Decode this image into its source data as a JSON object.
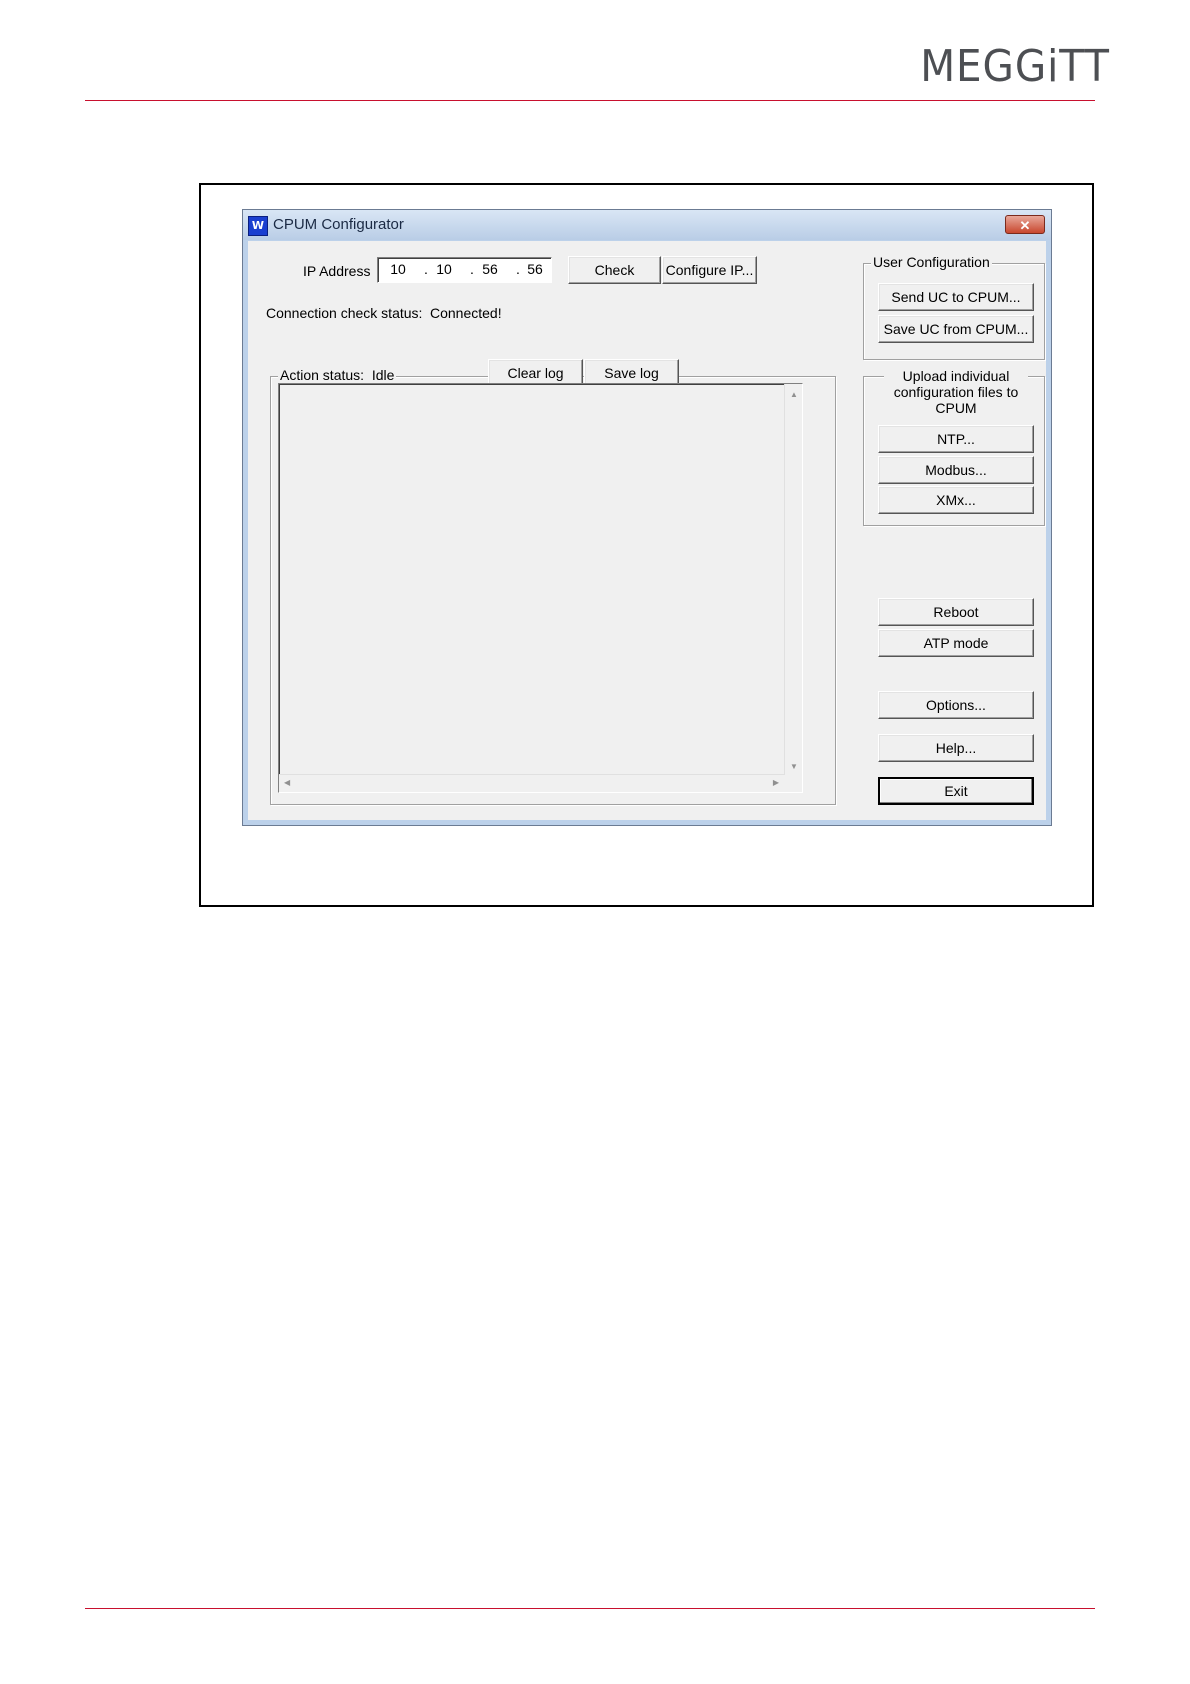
{
  "header": {
    "logo_text": "MEGGiTT"
  },
  "window": {
    "title": "CPUM Configurator",
    "close_glyph": "✕",
    "ip": {
      "label": "IP Address",
      "octets": [
        "10",
        "10",
        "56",
        "56"
      ],
      "separator": "."
    },
    "buttons": {
      "check": "Check",
      "configure_ip": "Configure IP...",
      "clear_log": "Clear log",
      "save_log": "Save log",
      "reboot": "Reboot",
      "atp_mode": "ATP mode",
      "options": "Options...",
      "help": "Help...",
      "exit": "Exit"
    },
    "connection": {
      "label": "Connection check status:",
      "value": "Connected!"
    },
    "action": {
      "label": "Action status:",
      "value": "Idle"
    },
    "user_configuration": {
      "title": "User Configuration",
      "send": "Send UC to CPUM...",
      "save": "Save UC from CPUM..."
    },
    "upload_group": {
      "title_line1": "Upload individual",
      "title_line2": "configuration files to",
      "title_line3": "CPUM",
      "ntp": "NTP...",
      "modbus": "Modbus...",
      "xmx": "XMx..."
    }
  },
  "colors": {
    "accent_rule": "#c8102e",
    "logo": "#4d4f53",
    "window_face": "#f0f0f0"
  }
}
